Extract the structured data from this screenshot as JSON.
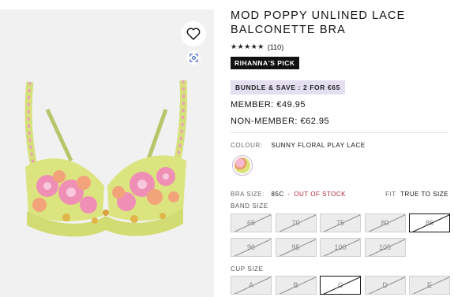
{
  "product": {
    "title": "MOD POPPY UNLINED LACE BALCONETTE BRA",
    "rating_stars": "★★★★★",
    "review_count": "(110)",
    "pick_badge": "RIHANNA'S PICK",
    "bundle_badge": "BUNDLE & SAVE : 2 FOR €65",
    "member_price": "MEMBER: €49.95",
    "non_member_price": "NON-MEMBER: €62.95"
  },
  "image": {
    "wishlist_icon": "heart-icon",
    "lens_icon": "visual-search-icon"
  },
  "colour": {
    "label": "COLOUR:",
    "value": "SUNNY FLORAL PLAY LACE"
  },
  "size": {
    "label": "BRA SIZE:",
    "selected": "85C",
    "separator": "-",
    "status": "OUT OF STOCK",
    "fit_label": "FIT",
    "fit_value": "TRUE TO SIZE"
  },
  "band": {
    "label": "BAND SIZE",
    "options": [
      {
        "label": "65",
        "unavailable": true,
        "selected": false
      },
      {
        "label": "70",
        "unavailable": true,
        "selected": false
      },
      {
        "label": "75",
        "unavailable": true,
        "selected": false
      },
      {
        "label": "80",
        "unavailable": true,
        "selected": false
      },
      {
        "label": "85",
        "unavailable": true,
        "selected": true
      },
      {
        "label": "90",
        "unavailable": true,
        "selected": false
      },
      {
        "label": "95",
        "unavailable": true,
        "selected": false
      },
      {
        "label": "100",
        "unavailable": true,
        "selected": false
      },
      {
        "label": "105",
        "unavailable": true,
        "selected": false
      }
    ]
  },
  "cup": {
    "label": "CUP SIZE",
    "options": [
      {
        "label": "A",
        "unavailable": true,
        "selected": false
      },
      {
        "label": "B",
        "unavailable": true,
        "selected": false
      },
      {
        "label": "C",
        "unavailable": true,
        "selected": true
      },
      {
        "label": "D",
        "unavailable": true,
        "selected": false
      },
      {
        "label": "E",
        "unavailable": true,
        "selected": false
      }
    ]
  },
  "colors": {
    "oos_red": "#b0243b",
    "bundle_bg": "#e3dff0",
    "panel_bg": "#f1f1f1"
  }
}
